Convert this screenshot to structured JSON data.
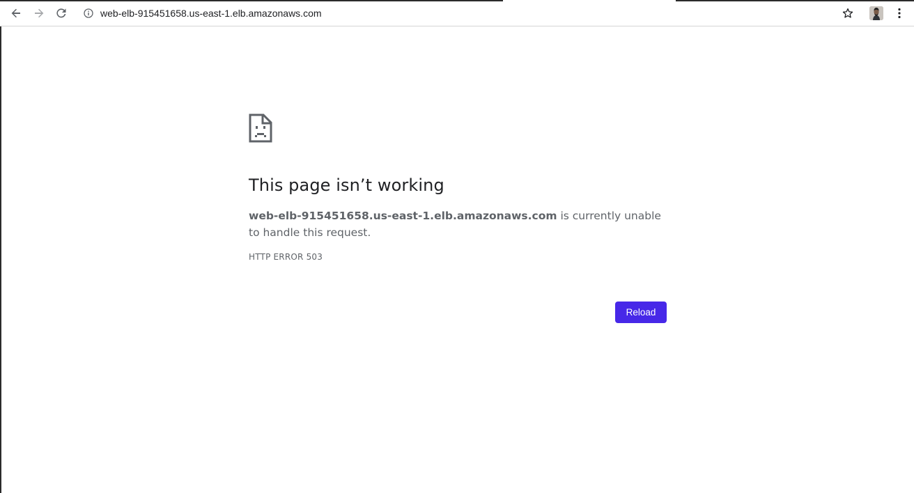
{
  "browser": {
    "url": "web-elb-915451658.us-east-1.elb.amazonaws.com",
    "icons": {
      "back": "arrow-left",
      "forward": "arrow-right",
      "reload": "reload",
      "site_info": "info-circle",
      "bookmark": "star-outline",
      "profile": "avatar",
      "menu": "kebab-menu"
    }
  },
  "error_page": {
    "icon": "sad-page",
    "title": "This page isn’t working",
    "host": "web-elb-915451658.us-east-1.elb.amazonaws.com",
    "message": " is currently unable to handle this request.",
    "code": "HTTP ERROR 503",
    "reload_label": "Reload"
  },
  "colors": {
    "accent": "#4728e8",
    "title_text": "#202124",
    "body_text": "#5f6368"
  }
}
